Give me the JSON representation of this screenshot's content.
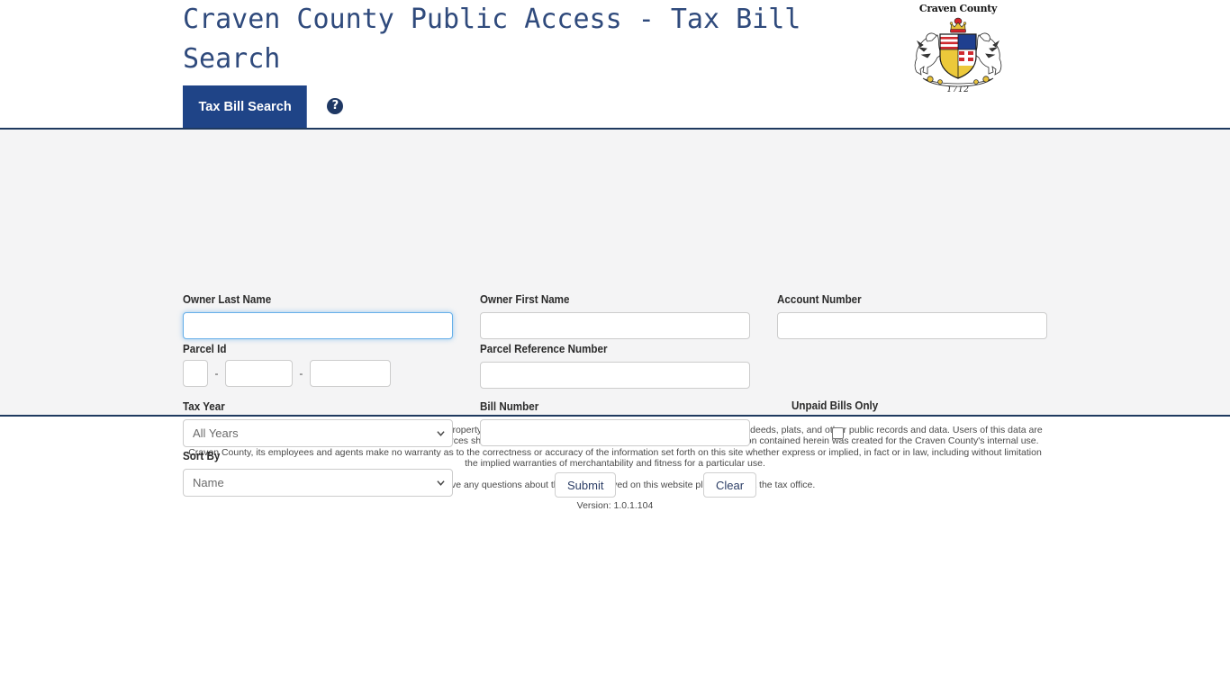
{
  "header": {
    "title": "Craven County Public Access - Tax Bill Search",
    "logo": {
      "name": "Craven County",
      "year": "1712",
      "alt": "craven-county-coat-of-arms"
    },
    "tabs": [
      {
        "label": "Tax Bill Search",
        "active": true
      }
    ],
    "help_icon": "?"
  },
  "form": {
    "owner_last_name": {
      "label": "Owner Last Name",
      "value": "",
      "placeholder": "",
      "focused": true
    },
    "owner_first_name": {
      "label": "Owner First Name",
      "value": "",
      "placeholder": ""
    },
    "account_number": {
      "label": "Account Number",
      "value": "",
      "placeholder": ""
    },
    "parcel_id": {
      "label": "Parcel Id",
      "separator": "-",
      "parts": [
        {
          "value": "",
          "placeholder": ""
        },
        {
          "value": "",
          "placeholder": ""
        },
        {
          "value": "",
          "placeholder": ""
        }
      ]
    },
    "parcel_reference_number": {
      "label": "Parcel Reference Number",
      "value": "",
      "placeholder": ""
    },
    "tax_year": {
      "label": "Tax Year",
      "selected": "All Years",
      "options": [
        "All Years"
      ]
    },
    "bill_number": {
      "label": "Bill Number",
      "value": "",
      "placeholder": ""
    },
    "unpaid_bills_only": {
      "label": "Unpaid Bills Only",
      "checked": false
    },
    "sort_by": {
      "label": "Sort By",
      "selected": "Name",
      "options": [
        "Name"
      ]
    },
    "submit_label": "Submit",
    "clear_label": "Clear"
  },
  "footer": {
    "disclaimer": "All information on this site is prepared for the inventory of real property found within Craven County. All data is compiled from recorded deeds, plats, and other public records and data. Users of this data are hereby notified that the aforementioned public information sources should be consulted for verification of the information. All information contained herein was created for the Craven County's internal use. Craven County, its employees and agents make no warranty as to the correctness or accuracy of the information set forth on this site whether express or implied, in fact or in law, including without limitation the implied warranties of merchantability and fitness for a particular use.",
    "contact": "If you have any questions about the data displayed on this website please contact the tax office.",
    "version": "Version: 1.0.1.104"
  },
  "colors": {
    "title": "#2f4a7c",
    "tab_active": "#1f4487",
    "rule": "#1f3a5f",
    "panel_bg": "#f4f4f5",
    "focus_ring": "#66afe9",
    "button_text": "#2c3e66"
  }
}
